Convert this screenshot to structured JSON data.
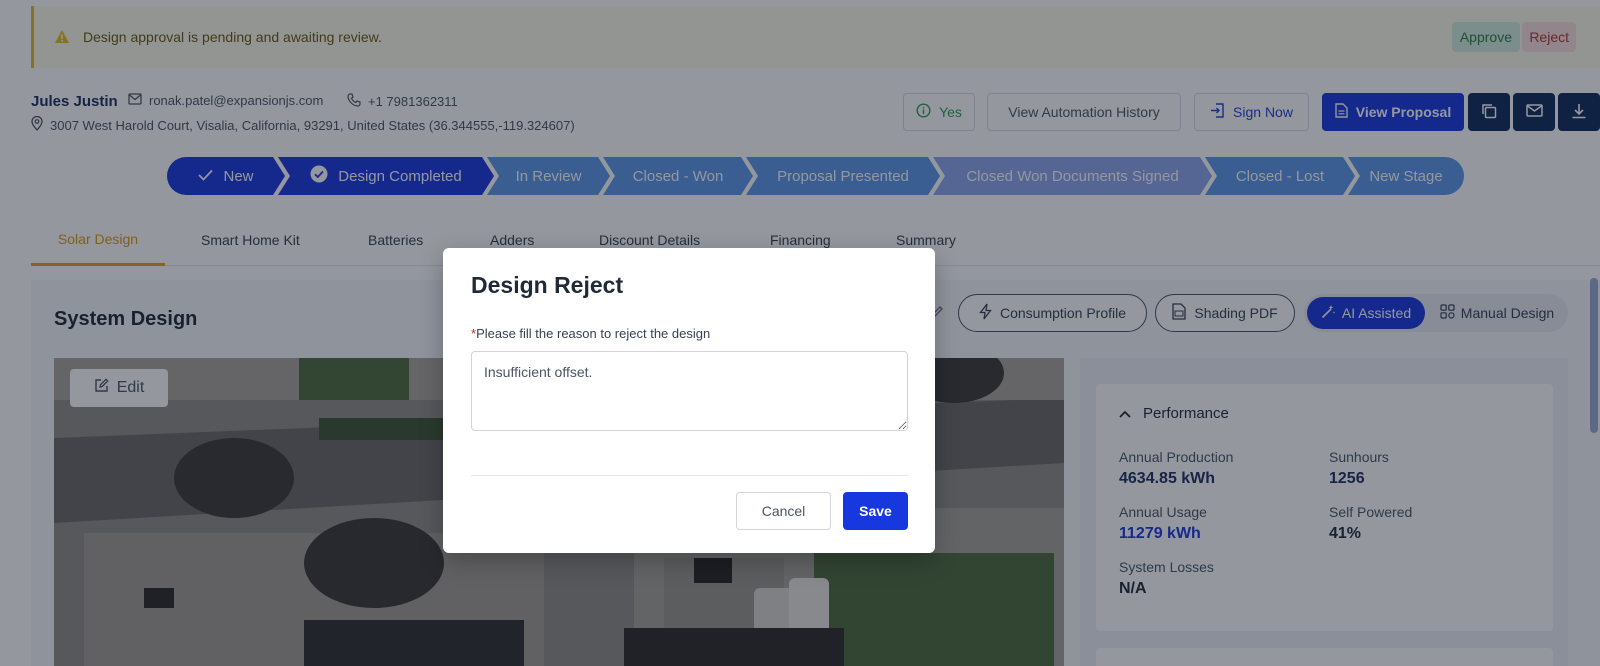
{
  "alert": {
    "message": "Design approval is pending and awaiting review.",
    "approve_label": "Approve",
    "reject_label": "Reject"
  },
  "customer": {
    "name": "Jules Justin",
    "email": "ronak.patel@expansionjs.com",
    "phone": "+1 7981362311",
    "address": "3007 West Harold Court, Visalia, California, 93291, United States (36.344555,-119.324607)"
  },
  "actions": {
    "yes_label": "Yes",
    "automation_history_label": "View Automation History",
    "sign_now_label": "Sign Now",
    "view_proposal_label": "View Proposal"
  },
  "pipeline": [
    {
      "label": "New",
      "status": "done"
    },
    {
      "label": "Design Completed",
      "status": "current"
    },
    {
      "label": "In Review",
      "status": "upcoming"
    },
    {
      "label": "Closed - Won",
      "status": "upcoming"
    },
    {
      "label": "Proposal Presented",
      "status": "upcoming"
    },
    {
      "label": "Closed Won Documents Signed",
      "status": "upcoming"
    },
    {
      "label": "Closed - Lost",
      "status": "upcoming"
    },
    {
      "label": "New Stage",
      "status": "upcoming"
    }
  ],
  "tabs": [
    {
      "label": "Solar Design",
      "active": true
    },
    {
      "label": "Smart Home Kit",
      "active": false
    },
    {
      "label": "Batteries",
      "active": false
    },
    {
      "label": "Adders",
      "active": false
    },
    {
      "label": "Discount Details",
      "active": false
    },
    {
      "label": "Financing",
      "active": false
    },
    {
      "label": "Summary",
      "active": false
    }
  ],
  "system_design": {
    "title": "System Design",
    "edit_label": "Edit",
    "consumption_profile_label": "Consumption Profile",
    "shading_pdf_label": "Shading PDF",
    "ai_assisted_label": "AI Assisted",
    "manual_design_label": "Manual Design",
    "mode_selected": "AI Assisted"
  },
  "performance": {
    "title": "Performance",
    "annual_production_label": "Annual Production",
    "annual_production_value": "4634.85 kWh",
    "sunhours_label": "Sunhours",
    "sunhours_value": "1256",
    "annual_usage_label": "Annual Usage",
    "annual_usage_value": "11279 kWh",
    "self_powered_label": "Self Powered",
    "self_powered_value": "41%",
    "system_losses_label": "System Losses",
    "system_losses_value": "N/A"
  },
  "modal": {
    "title": "Design Reject",
    "required_marker": "*",
    "label": "Please fill the reason to reject the design",
    "reason_value": "Insufficient offset.",
    "cancel_label": "Cancel",
    "save_label": "Save"
  },
  "colors": {
    "primary": "#1838df",
    "navy": "#0e2a5a",
    "warning": "#e4bd15",
    "active_tab": "#e3a221"
  }
}
